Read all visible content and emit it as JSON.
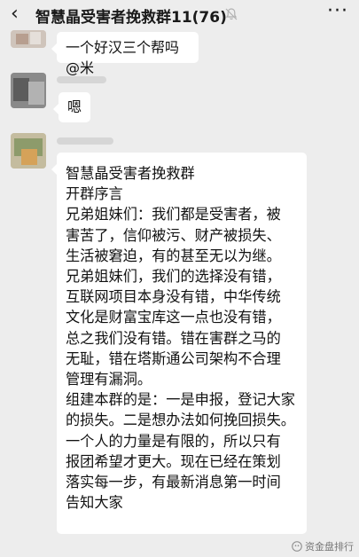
{
  "header": {
    "back_icon": "chevron-left-icon",
    "title": "智慧晶受害者挽救群11(76)",
    "mute_icon": "bell-off-icon",
    "more_label": "···"
  },
  "messages": [
    {
      "text": "一个好汉三个帮吗@米"
    },
    {
      "text": "嗯"
    },
    {
      "text": "智慧晶受害者挽救群\n开群序言\n兄弟姐妹们：我们都是受害者，被\n害苦了，信仰被污、财产被损失、\n生活被窘迫，有的甚至无以为继。\n兄弟姐妹们，我们的选择没有错，\n互联网项目本身没有错，中华传统\n文化是财富宝库这一点也没有错，\n总之我们没有错。错在害群之马的\n无耻，错在塔斯通公司架构不合理\n管理有漏洞。\n组建本群的是：一是申报，登记大家\n的损失。二是想办法如何挽回损失。\n一个人的力量是有限的，所以只有\n报团希望才更大。现在已经在策划\n落实每一步，有最新消息第一时间\n告知大家"
    }
  ],
  "watermark": {
    "text": "资金盘排行",
    "icon": "wechat-official-account-icon"
  }
}
